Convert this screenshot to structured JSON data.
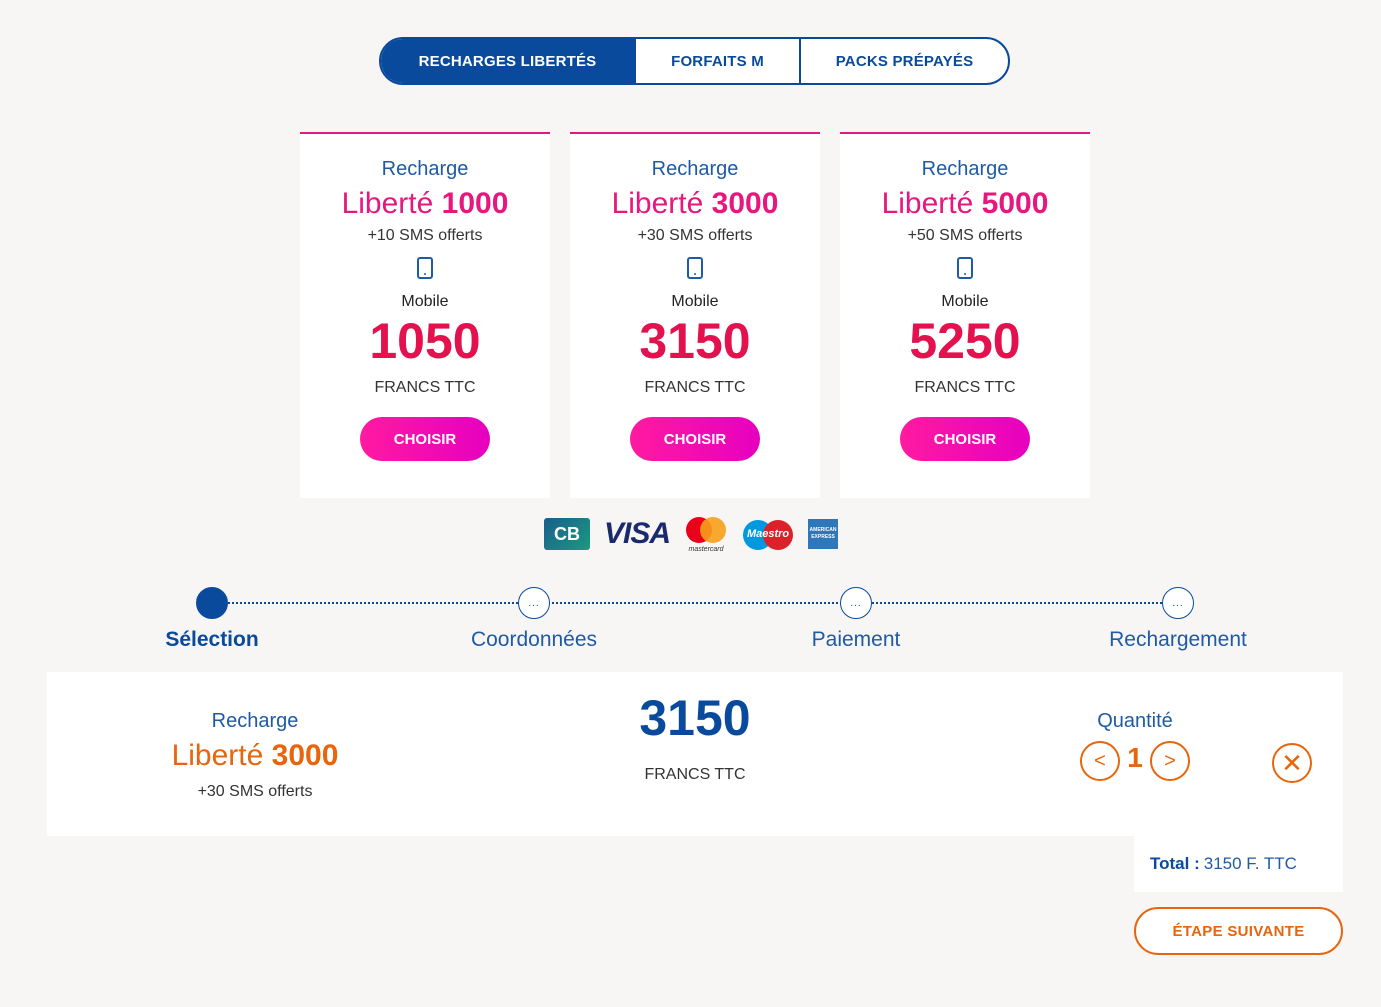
{
  "tabs": [
    {
      "label": "RECHARGES LIBERTÉS",
      "active": true
    },
    {
      "label": "FORFAITS M",
      "active": false
    },
    {
      "label": "PACKS PRÉPAYÉS",
      "active": false
    }
  ],
  "offers": [
    {
      "kind": "Recharge",
      "name_prefix": "Liberté",
      "name_amount": "1000",
      "bonus": "+10 SMS offerts",
      "device": "Mobile",
      "price": "1050",
      "currency": "FRANCS TTC",
      "cta": "CHOISIR"
    },
    {
      "kind": "Recharge",
      "name_prefix": "Liberté",
      "name_amount": "3000",
      "bonus": "+30 SMS offerts",
      "device": "Mobile",
      "price": "3150",
      "currency": "FRANCS TTC",
      "cta": "CHOISIR"
    },
    {
      "kind": "Recharge",
      "name_prefix": "Liberté",
      "name_amount": "5000",
      "bonus": "+50 SMS offerts",
      "device": "Mobile",
      "price": "5250",
      "currency": "FRANCS TTC",
      "cta": "CHOISIR"
    }
  ],
  "payment_logos": {
    "cb": "CB",
    "visa": "VISA",
    "mastercard": "mastercard",
    "maestro": "Maestro",
    "amex_line1": "AMERICAN",
    "amex_line2": "EXPRESS"
  },
  "steps": [
    {
      "label": "Sélection",
      "active": true
    },
    {
      "label": "Coordonnées",
      "active": false
    },
    {
      "label": "Paiement",
      "active": false
    },
    {
      "label": "Rechargement",
      "active": false
    }
  ],
  "selection": {
    "kind": "Recharge",
    "name_prefix": "Liberté",
    "name_amount": "3000",
    "bonus": "+30 SMS offerts",
    "price": "3150",
    "currency": "FRANCS TTC",
    "quantity_label": "Quantité",
    "quantity": "1",
    "decrement": "<",
    "increment": ">",
    "remove": "✕"
  },
  "total": {
    "label": "Total :",
    "value": "3150 F. TTC"
  },
  "next_button": "ÉTAPE SUIVANTE",
  "colors": {
    "brand_blue": "#0a4a9c",
    "pink": "#e6177e",
    "price_red": "#e3124f",
    "orange": "#e8650c"
  }
}
